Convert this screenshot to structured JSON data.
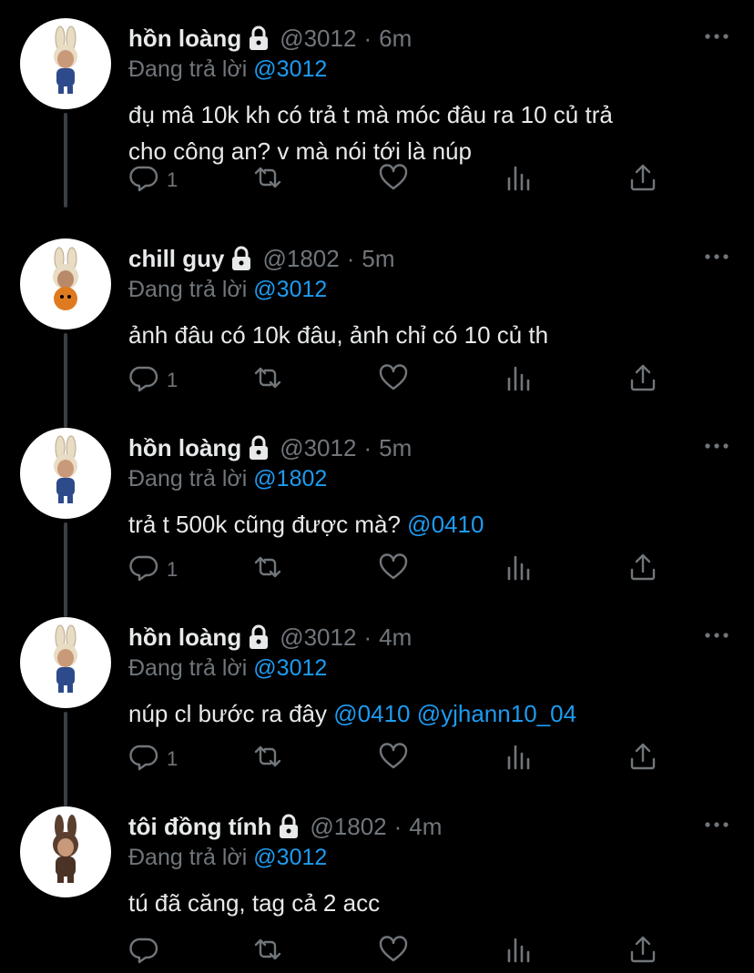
{
  "tweets": [
    {
      "name": "hồn loàng",
      "handle": "@3012",
      "time": "6m",
      "replying_prefix": "Đang trả lời",
      "replying_to": "@3012",
      "text_lines": [
        "đụ mâ 10k kh có trả t mà móc đâu ra 10 củ trả",
        "cho công an? v mà nói tới là núp"
      ],
      "mentions": [],
      "reply_count": "1"
    },
    {
      "name": "chill guy",
      "handle": "@1802",
      "time": "5m",
      "replying_prefix": "Đang trả lời",
      "replying_to": "@3012",
      "text_lines": [
        "ảnh đâu có 10k đâu, ảnh chỉ có 10 củ th"
      ],
      "mentions": [],
      "reply_count": "1"
    },
    {
      "name": "hồn loàng",
      "handle": "@3012",
      "time": "5m",
      "replying_prefix": "Đang trả lời",
      "replying_to": "@1802",
      "text_lines": [
        "trả t 500k cũng được mà?"
      ],
      "mentions": [
        "@0410"
      ],
      "reply_count": "1"
    },
    {
      "name": "hồn loàng",
      "handle": "@3012",
      "time": "4m",
      "replying_prefix": "Đang trả lời",
      "replying_to": "@3012",
      "text_lines": [
        "núp cl bước ra đây"
      ],
      "mentions": [
        "@0410",
        "@yjhann10_04"
      ],
      "reply_count": "1"
    },
    {
      "name": "tôi đồng tính",
      "handle": "@1802",
      "time": "4m",
      "replying_prefix": "Đang trả lời",
      "replying_to": "@3012",
      "text_lines": [
        "tú đã căng, tag cả 2 acc"
      ],
      "mentions": [],
      "reply_count": ""
    }
  ],
  "separator": "·",
  "icons": {
    "lock": "lock-icon",
    "more": "more-icon",
    "reply": "reply-icon",
    "retweet": "retweet-icon",
    "like": "like-icon",
    "views": "views-icon",
    "share": "share-icon"
  },
  "colors": {
    "background": "#000000",
    "text": "#e7e9ea",
    "muted": "#71767b",
    "accent": "#1d9bf0",
    "thread_line": "#3a3f44"
  }
}
